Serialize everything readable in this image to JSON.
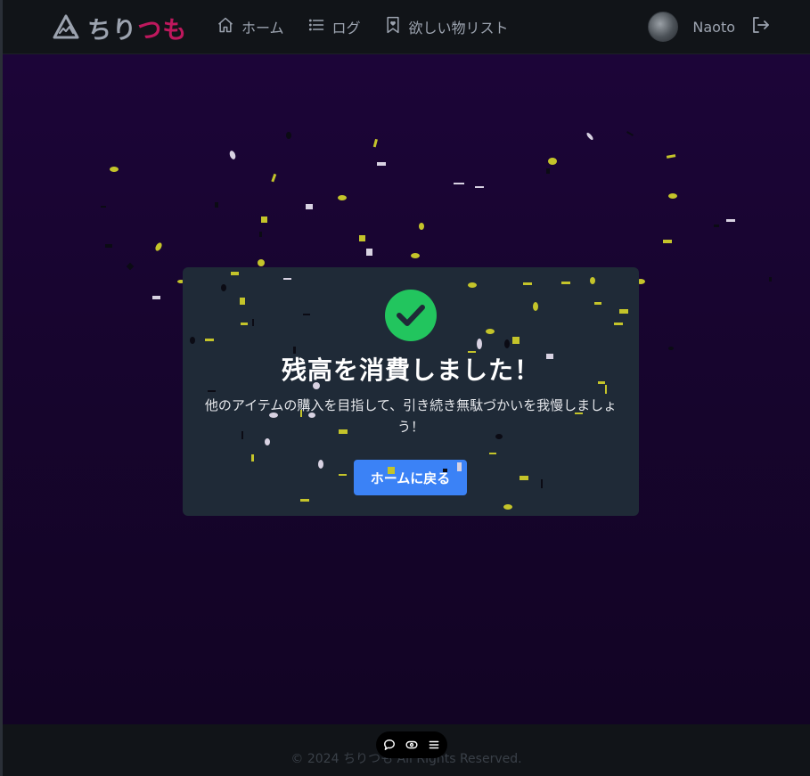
{
  "header": {
    "brand_part1": "ちり",
    "brand_part2": "つも",
    "nav": [
      {
        "label": "ホーム",
        "icon": "home-icon"
      },
      {
        "label": "ログ",
        "icon": "list-icon"
      },
      {
        "label": "欲しい物リスト",
        "icon": "bookmark-icon"
      }
    ],
    "user_name": "Naoto"
  },
  "dialog": {
    "title": "残高を消費しました！",
    "message": "他のアイテムの購入を目指して、引き続き無駄づかいを我慢しましょう！",
    "button_label": "ホームに戻る"
  },
  "footer": {
    "copyright": "© 2024 ちりつも All Rights Reserved."
  },
  "colors": {
    "accent": "#3b82f6",
    "success": "#22c55e",
    "brand_pink": "#be185d",
    "confetti_yellow": "#c4c42a",
    "confetti_white": "#d8d2e2",
    "confetti_dark": "#0b0b14"
  }
}
